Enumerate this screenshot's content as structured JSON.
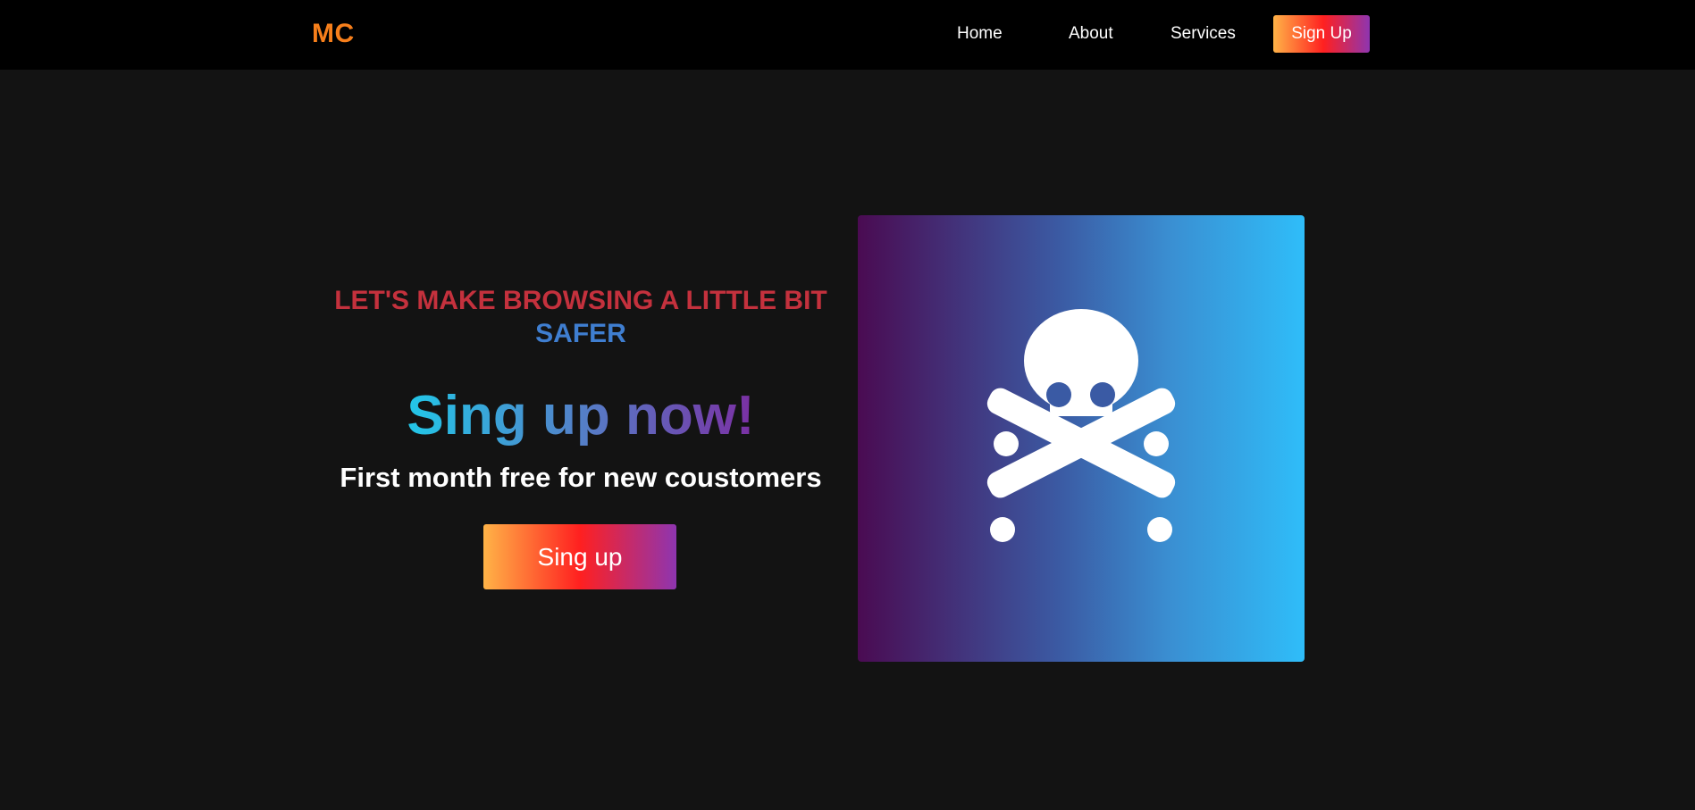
{
  "navbar": {
    "logo": "MC",
    "links": [
      "Home",
      "About",
      "Services"
    ],
    "signup_label": "Sign Up"
  },
  "hero": {
    "tagline_line1": "LET'S MAKE BROWSING A LITTLE BIT",
    "tagline_line2": "SAFER",
    "headline": "Sing up now!",
    "subheadline": "First month free for new coustomers",
    "cta_label": "Sing up",
    "image_icon": "skull-crossbones-icon"
  },
  "colors": {
    "logo": "#f77f1b",
    "tagline_red": "#c4313d",
    "tagline_blue": "#3f7ed0",
    "background": "#131313",
    "navbar": "#000000"
  }
}
